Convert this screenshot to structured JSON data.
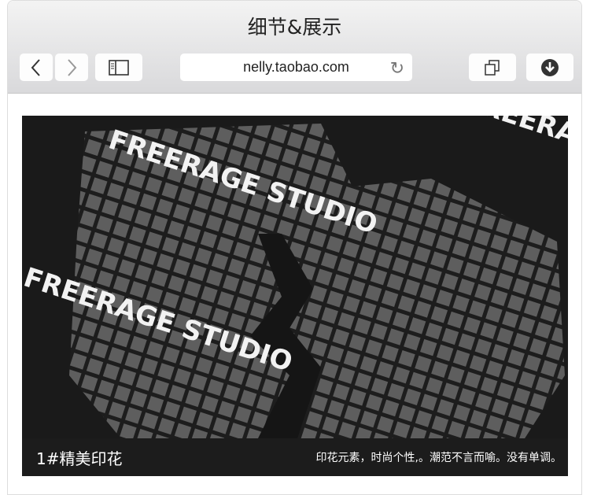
{
  "browser": {
    "title": "细节&展示",
    "url": "nelly.taobao.com"
  },
  "icons": {
    "back": "chevron-left-icon",
    "forward": "chevron-right-icon",
    "sidebar": "sidebar-icon",
    "reload": "reload-icon",
    "tabs": "tabs-icon",
    "download": "download-icon"
  },
  "image": {
    "print_text": "FREERAGE STUDIO"
  },
  "caption": {
    "title": "1#精美印花",
    "description": "印花元素，时尚个性,。潮范不言而喻。没有单调。"
  }
}
